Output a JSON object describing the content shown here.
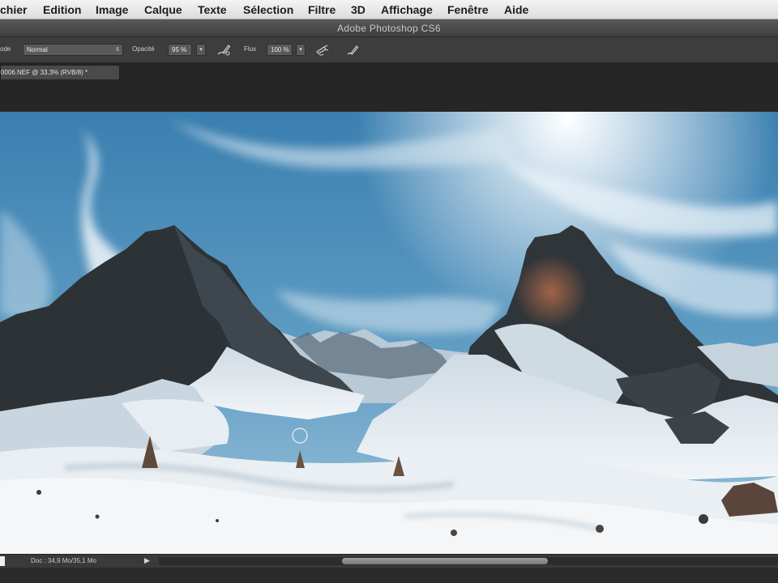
{
  "menubar": {
    "items": [
      "chier",
      "Edition",
      "Image",
      "Calque",
      "Texte",
      "Sélection",
      "Filtre",
      "3D",
      "Affichage",
      "Fenêtre",
      "Aide"
    ]
  },
  "window": {
    "title": "Adobe Photoshop CS6"
  },
  "options": {
    "mode_label": "ode",
    "mode_value": "Normal",
    "opacity_label": "Opacité",
    "opacity_value": "95 %",
    "flow_label": "Flux",
    "flow_value": "100 %"
  },
  "document": {
    "tab_label": "0006.NEF @ 33,3% (RVB/8) *"
  },
  "status": {
    "doc_info": "Doc : 34,9 Mo/35,1 Mo",
    "arrow": "▶"
  },
  "icons": {
    "pressure_opacity": "pen-pressure-icon",
    "airbrush": "airbrush-icon",
    "pressure_size": "pen-pressure-size-icon"
  }
}
